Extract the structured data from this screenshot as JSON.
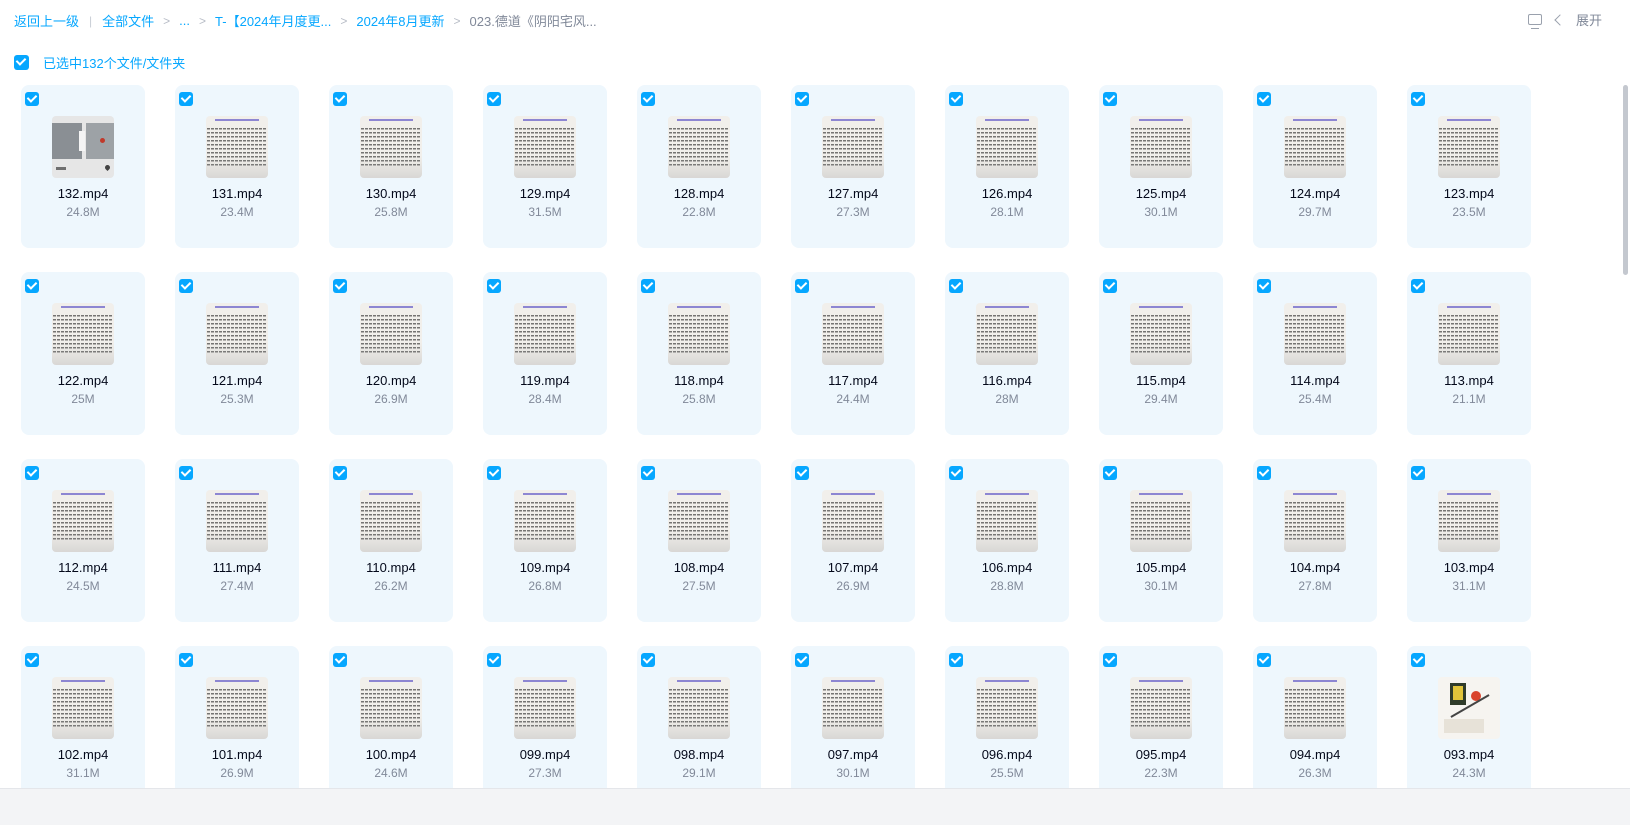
{
  "breadcrumb": {
    "back": "返回上一级",
    "all_files": "全部文件",
    "ellipsis": "...",
    "level1": "T-【2024年月度更...",
    "level2": "2024年8月更新",
    "current": "023.德道《阴阳宅风..."
  },
  "toolbar": {
    "expand_label": "展开",
    "icons": [
      "monitor-icon",
      "chevron-left-icon"
    ]
  },
  "selection": {
    "label": "已选中132个文件/文件夹",
    "all_checked": true
  },
  "colors": {
    "accent": "#06a7ff",
    "card_bg": "#eef7fd",
    "text_primary": "#03081a",
    "text_secondary": "#818999"
  },
  "files": [
    {
      "name": "132.mp4",
      "size": "24.8M",
      "thumb": "photo"
    },
    {
      "name": "131.mp4",
      "size": "23.4M",
      "thumb": "text"
    },
    {
      "name": "130.mp4",
      "size": "25.8M",
      "thumb": "text"
    },
    {
      "name": "129.mp4",
      "size": "31.5M",
      "thumb": "text"
    },
    {
      "name": "128.mp4",
      "size": "22.8M",
      "thumb": "text"
    },
    {
      "name": "127.mp4",
      "size": "27.3M",
      "thumb": "text"
    },
    {
      "name": "126.mp4",
      "size": "28.1M",
      "thumb": "text"
    },
    {
      "name": "125.mp4",
      "size": "30.1M",
      "thumb": "text"
    },
    {
      "name": "124.mp4",
      "size": "29.7M",
      "thumb": "text"
    },
    {
      "name": "123.mp4",
      "size": "23.5M",
      "thumb": "text"
    },
    {
      "name": "122.mp4",
      "size": "25M",
      "thumb": "text"
    },
    {
      "name": "121.mp4",
      "size": "25.3M",
      "thumb": "text"
    },
    {
      "name": "120.mp4",
      "size": "26.9M",
      "thumb": "text"
    },
    {
      "name": "119.mp4",
      "size": "28.4M",
      "thumb": "text"
    },
    {
      "name": "118.mp4",
      "size": "25.8M",
      "thumb": "text"
    },
    {
      "name": "117.mp4",
      "size": "24.4M",
      "thumb": "text"
    },
    {
      "name": "116.mp4",
      "size": "28M",
      "thumb": "text"
    },
    {
      "name": "115.mp4",
      "size": "29.4M",
      "thumb": "text"
    },
    {
      "name": "114.mp4",
      "size": "25.4M",
      "thumb": "text"
    },
    {
      "name": "113.mp4",
      "size": "21.1M",
      "thumb": "text"
    },
    {
      "name": "112.mp4",
      "size": "24.5M",
      "thumb": "text"
    },
    {
      "name": "111.mp4",
      "size": "27.4M",
      "thumb": "text"
    },
    {
      "name": "110.mp4",
      "size": "26.2M",
      "thumb": "text"
    },
    {
      "name": "109.mp4",
      "size": "26.8M",
      "thumb": "text"
    },
    {
      "name": "108.mp4",
      "size": "27.5M",
      "thumb": "text"
    },
    {
      "name": "107.mp4",
      "size": "26.9M",
      "thumb": "text"
    },
    {
      "name": "106.mp4",
      "size": "28.8M",
      "thumb": "text"
    },
    {
      "name": "105.mp4",
      "size": "30.1M",
      "thumb": "text"
    },
    {
      "name": "104.mp4",
      "size": "27.8M",
      "thumb": "text"
    },
    {
      "name": "103.mp4",
      "size": "31.1M",
      "thumb": "text"
    },
    {
      "name": "102.mp4",
      "size": "31.1M",
      "thumb": "text"
    },
    {
      "name": "101.mp4",
      "size": "26.9M",
      "thumb": "text"
    },
    {
      "name": "100.mp4",
      "size": "24.6M",
      "thumb": "text"
    },
    {
      "name": "099.mp4",
      "size": "27.3M",
      "thumb": "text"
    },
    {
      "name": "098.mp4",
      "size": "29.1M",
      "thumb": "text"
    },
    {
      "name": "097.mp4",
      "size": "30.1M",
      "thumb": "text"
    },
    {
      "name": "096.mp4",
      "size": "25.5M",
      "thumb": "text"
    },
    {
      "name": "095.mp4",
      "size": "22.3M",
      "thumb": "text"
    },
    {
      "name": "094.mp4",
      "size": "26.3M",
      "thumb": "text"
    },
    {
      "name": "093.mp4",
      "size": "24.3M",
      "thumb": "art"
    }
  ]
}
